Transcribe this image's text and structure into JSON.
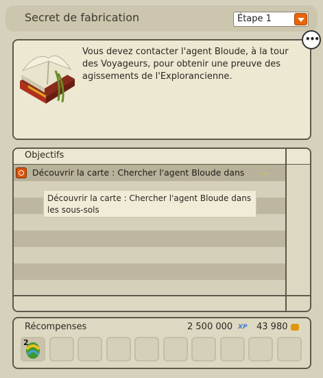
{
  "header": {
    "title": "Secret de fabrication",
    "step_select": "Étape 1"
  },
  "description": {
    "text": "Vous devez contacter l'agent Bloude, à la tour des Voyageurs, pour obtenir une preuve des agissements de l'Explorancienne."
  },
  "objectives": {
    "title": "Objectifs",
    "items": [
      {
        "text": "Découvrir la carte : Chercher l'agent Bloude dans",
        "ellipsis": "..."
      }
    ],
    "tooltip": "Découvrir la carte : Chercher l'agent Bloude dans les sous-sols"
  },
  "rewards": {
    "title": "Récompenses",
    "xp": "2 500 000",
    "kamas": "43 980",
    "item_qty": "2"
  },
  "icons": {
    "chat": "chat-bubble-icon",
    "book": "book-icon",
    "objective": "target-icon",
    "xp": "xp-icon",
    "kamas": "kamas-icon",
    "reward_item": "egg-item-icon"
  }
}
